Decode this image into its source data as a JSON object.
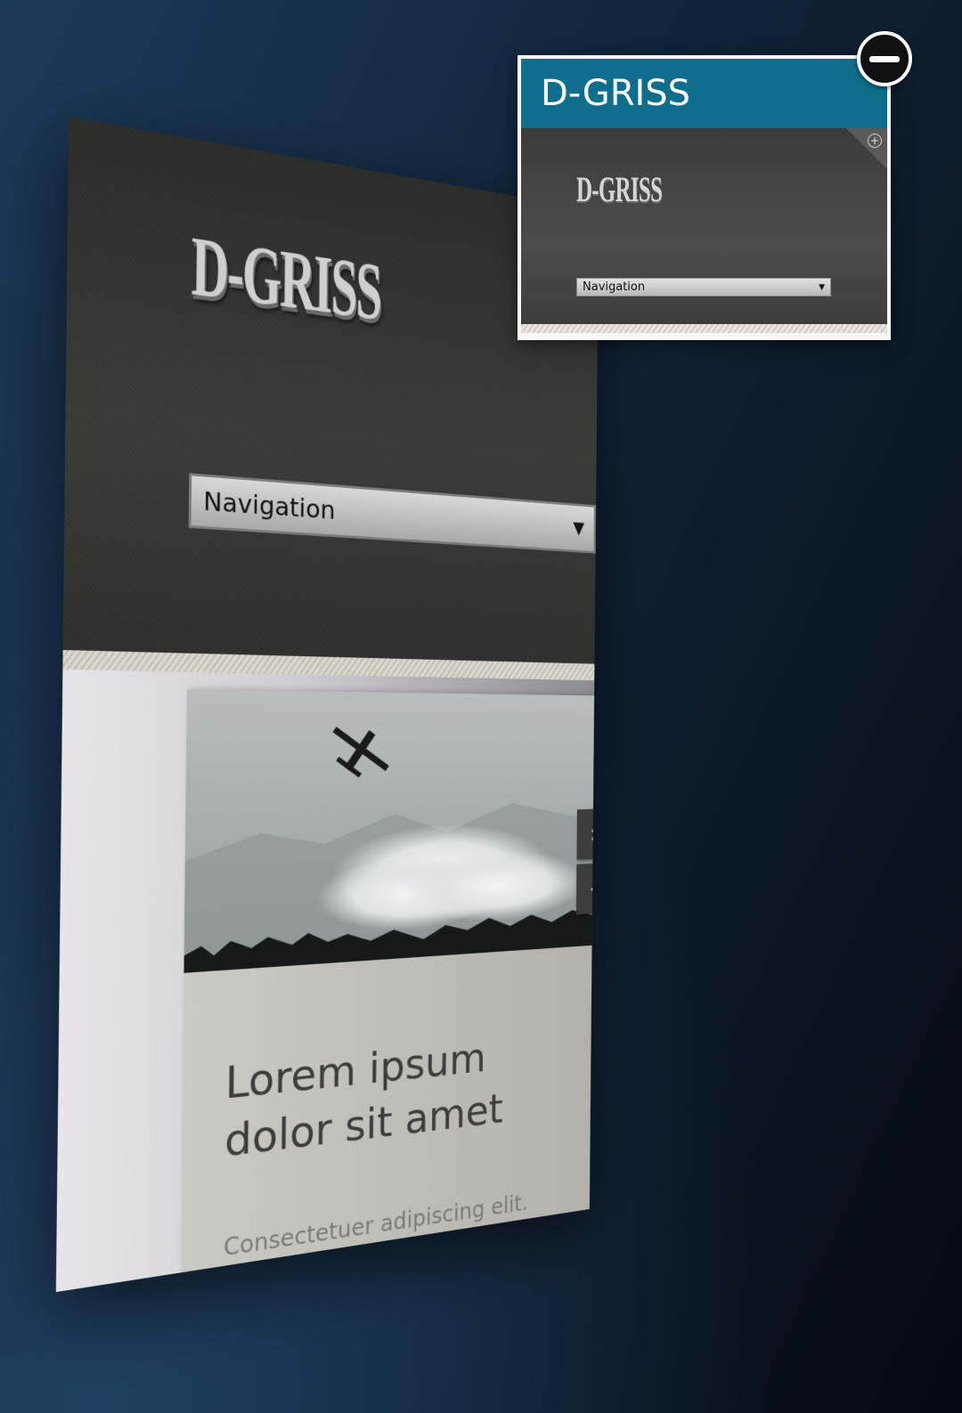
{
  "preview": {
    "logo_text": "D-GRISS",
    "navigation": {
      "selected": "Navigation",
      "caret": "▼"
    },
    "slider": {
      "next_glyph": "›",
      "prev_glyph": "‹"
    },
    "article": {
      "headline": "Lorem ipsum dolor sit amet",
      "subline": "Consectetuer adipiscing elit."
    }
  },
  "thumbnail": {
    "title": "D-GRISS",
    "logo_text": "D-GRISS",
    "expand_glyph": "+",
    "navigation": {
      "selected": "Navigation",
      "caret": "▼"
    }
  },
  "icons": {
    "close": "minus-circle-icon",
    "expand": "plus-circle-icon",
    "next": "chevron-right-icon",
    "prev": "chevron-left-icon",
    "dropdown": "caret-down-icon"
  },
  "colors": {
    "background_dark": "#040a12",
    "background_blue": "#1c3a59",
    "thumbnail_title_bar": "#0e6f8c",
    "header_dark": "#3a3b39"
  }
}
